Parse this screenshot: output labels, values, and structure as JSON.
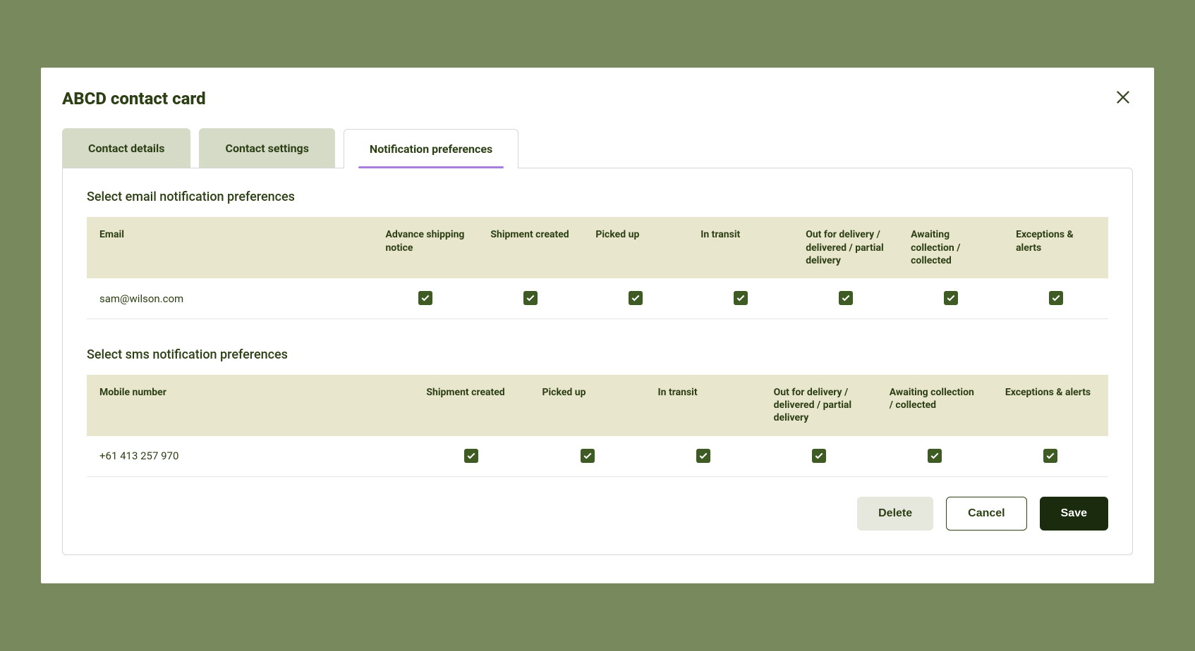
{
  "modal": {
    "title": "ABCD contact card"
  },
  "tabs": [
    {
      "label": "Contact details"
    },
    {
      "label": "Contact settings"
    },
    {
      "label": "Notification preferences"
    }
  ],
  "email_section": {
    "heading": "Select email notification preferences",
    "headers": [
      "Email",
      "Advance shipping notice",
      "Shipment created",
      "Picked up",
      "In transit",
      "Out for delivery / delivered / partial delivery",
      "Awaiting collection / collected",
      "Exceptions & alerts"
    ],
    "row": {
      "email": "sam@wilson.com",
      "checks": [
        true,
        true,
        true,
        true,
        true,
        true,
        true
      ]
    }
  },
  "sms_section": {
    "heading": "Select sms notification preferences",
    "headers": [
      "Mobile number",
      "Shipment created",
      "Picked up",
      "In transit",
      "Out for delivery / delivered / partial delivery",
      "Awaiting collection / collected",
      "Exceptions & alerts"
    ],
    "row": {
      "mobile": "+61 413 257 970",
      "checks": [
        true,
        true,
        true,
        true,
        true,
        true
      ]
    }
  },
  "buttons": {
    "delete": "Delete",
    "cancel": "Cancel",
    "save": "Save"
  }
}
